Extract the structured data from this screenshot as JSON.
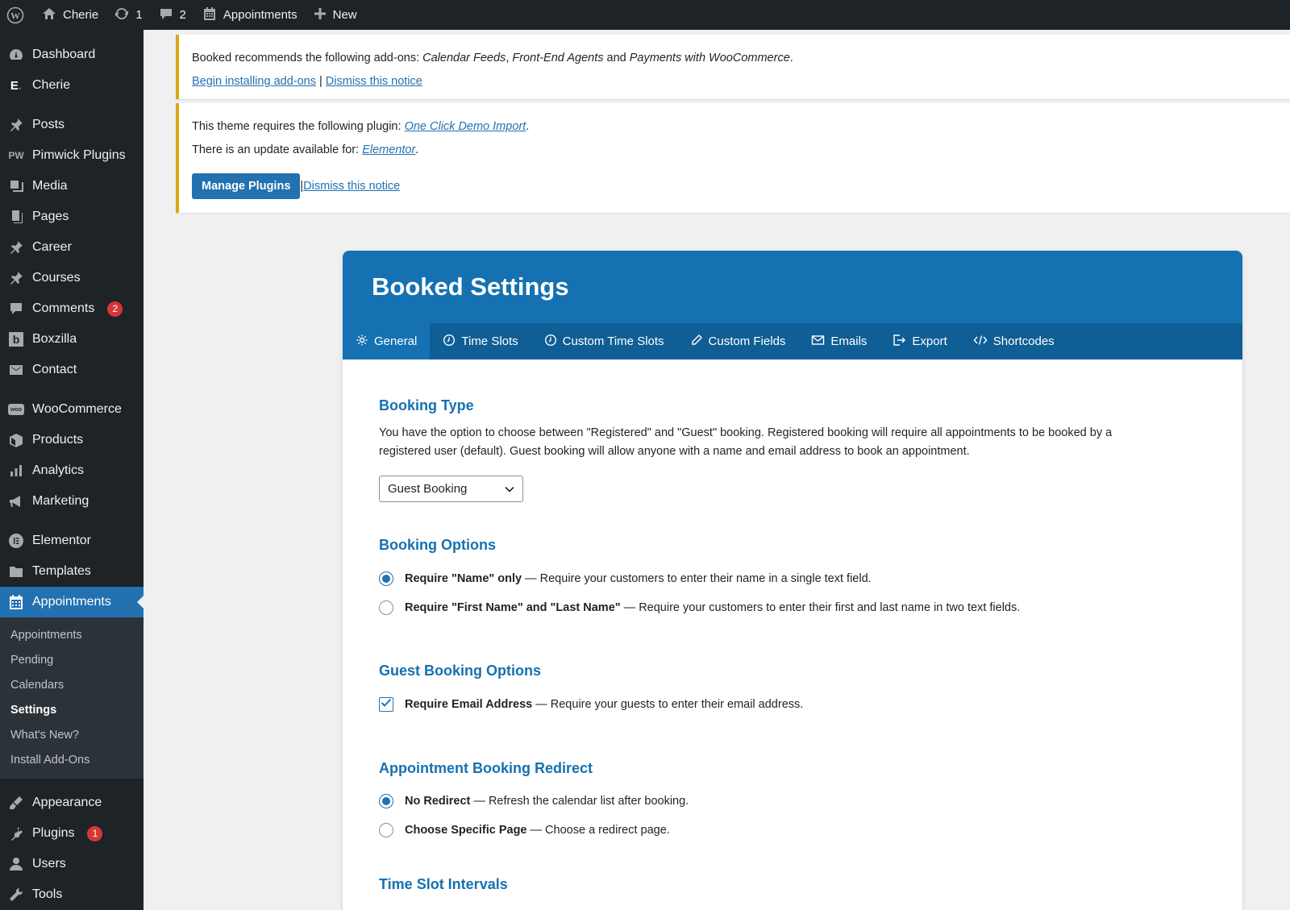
{
  "adminbar": {
    "site_name": "Cherie",
    "updates_count": "1",
    "comments_count": "2",
    "appointments_label": "Appointments",
    "new_label": "New"
  },
  "sidebar": {
    "items": [
      {
        "label": "Dashboard",
        "icon": "dashboard-icon"
      },
      {
        "label": "Cherie",
        "icon": "elementor-e-icon"
      },
      {
        "label": "Posts",
        "icon": "pin-icon"
      },
      {
        "label": "Pimwick Plugins",
        "icon": "pw-icon"
      },
      {
        "label": "Media",
        "icon": "media-icon"
      },
      {
        "label": "Pages",
        "icon": "pages-icon"
      },
      {
        "label": "Career",
        "icon": "pin-icon"
      },
      {
        "label": "Courses",
        "icon": "pin-icon"
      },
      {
        "label": "Comments",
        "icon": "comment-icon",
        "badge": "2"
      },
      {
        "label": "Boxzilla",
        "icon": "boxzilla-icon"
      },
      {
        "label": "Contact",
        "icon": "mail-icon"
      },
      {
        "label": "WooCommerce",
        "icon": "woo-icon"
      },
      {
        "label": "Products",
        "icon": "box-icon"
      },
      {
        "label": "Analytics",
        "icon": "bar-chart-icon"
      },
      {
        "label": "Marketing",
        "icon": "megaphone-icon"
      },
      {
        "label": "Elementor",
        "icon": "elementor-icon"
      },
      {
        "label": "Templates",
        "icon": "folder-icon"
      },
      {
        "label": "Appointments",
        "icon": "calendar-icon"
      },
      {
        "label": "Appearance",
        "icon": "brush-icon"
      },
      {
        "label": "Plugins",
        "icon": "plug-icon",
        "badge": "1"
      },
      {
        "label": "Users",
        "icon": "user-icon"
      },
      {
        "label": "Tools",
        "icon": "wrench-icon"
      }
    ],
    "submenu": [
      "Appointments",
      "Pending",
      "Calendars",
      "Settings",
      "What's New?",
      "Install Add-Ons"
    ]
  },
  "notice1": {
    "text_pre": "Booked recommends the following add-ons: ",
    "addon1": "Calendar Feeds",
    "sep1": ", ",
    "addon2": "Front-End Agents",
    "and": " and ",
    "addon3": "Payments with WooCommerce",
    "period": ".",
    "link_install": "Begin installing add-ons",
    "pipe": " | ",
    "link_dismiss": "Dismiss this notice"
  },
  "notice2": {
    "line1_pre": "This theme requires the following plugin: ",
    "line1_link": "One Click Demo Import",
    "line1_post": ".",
    "line2_pre": "There is an update available for: ",
    "line2_link": "Elementor",
    "line2_post": ".",
    "button": "Manage Plugins",
    "pipe": " | ",
    "link_dismiss": "Dismiss this notice"
  },
  "booked": {
    "title": "Booked Settings",
    "tabs": [
      "General",
      "Time Slots",
      "Custom Time Slots",
      "Custom Fields",
      "Emails",
      "Export",
      "Shortcodes"
    ],
    "booking_type": {
      "title": "Booking Type",
      "desc": "You have the option to choose between \"Registered\" and \"Guest\" booking. Registered booking will require all appointments to be booked by a registered user (default). Guest booking will allow anyone with a name and email address to book an appointment.",
      "selected": "Guest Booking"
    },
    "booking_options": {
      "title": "Booking Options",
      "opt1_bold": "Require \"Name\" only",
      "opt1_text": " — Require your customers to enter their name in a single text field.",
      "opt2_bold": "Require \"First Name\" and \"Last Name\"",
      "opt2_text": " — Require your customers to enter their first and last name in two text fields."
    },
    "guest_options": {
      "title": "Guest Booking Options",
      "opt_bold": "Require Email Address",
      "opt_text": " — Require your guests to enter their email address."
    },
    "redirect": {
      "title": "Appointment Booking Redirect",
      "opt1_bold": "No Redirect",
      "opt1_text": " — Refresh the calendar list after booking.",
      "opt2_bold": "Choose Specific Page",
      "opt2_text": " — Choose a redirect page."
    },
    "time_slot_intervals": {
      "title": "Time Slot Intervals"
    }
  }
}
